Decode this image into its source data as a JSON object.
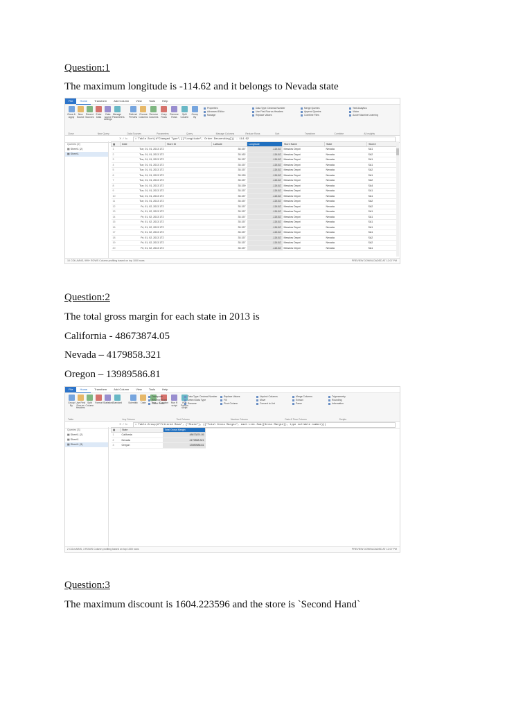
{
  "q1": {
    "heading": "Question:1",
    "text": "The maximum longitude is -114.62 and it belongs to Nevada state",
    "shot": {
      "tabs": [
        "File",
        "Home",
        "Transform",
        "Add Column",
        "View",
        "Tools",
        "Help"
      ],
      "ribbon_lists": [
        [
          "Properties",
          "Advanced Editor",
          "Manage"
        ],
        [
          "Data Type: Decimal Number",
          "Use First Row as Headers",
          "Replace Values"
        ],
        [
          "Merge Queries",
          "Append Queries",
          "Combine Files"
        ],
        [
          "Text Analytics",
          "Vision",
          "Azure Machine Learning"
        ]
      ],
      "ribbon_buttons": [
        "Close & Apply",
        "New Source",
        "Recent Sources",
        "Enter Data",
        "Data source settings",
        "Manage Parameters",
        "Refresh Preview",
        "Choose Columns",
        "Remove Columns",
        "Keep Rows",
        "Remove Rows",
        "Split Column",
        "Group By"
      ],
      "group_labels": [
        "Close",
        "New Query",
        "Data Sources",
        "Parameters",
        "Query",
        "Manage Columns",
        "Reduce Rows",
        "Sort",
        "Transform",
        "Combine",
        "AI Insights"
      ],
      "formula": "= Table.Sort(#\"Changed Type\",{{\"Longitude\", Order.Descending}}) - 114.62",
      "queries_header": "Queries [2]",
      "queries": [
        "Sheet1 (2)",
        "Sheet1"
      ],
      "columns": [
        "Date",
        "Store ID",
        "Latitude",
        "Longitude",
        "Store Name",
        "State",
        "Store2"
      ],
      "rows": [
        [
          "1",
          "Tue, 01, 01, 2013 1T2",
          "",
          "35.157",
          "-114.62",
          "Meadow Depot",
          "Nevada",
          "SA1"
        ],
        [
          "2",
          "Tue, 01, 01, 2013 1T2",
          "",
          "35.162",
          "-114.62",
          "Meadow Depot",
          "Nevada",
          "SA2"
        ],
        [
          "3",
          "Tue, 01, 01, 2013 1T2",
          "",
          "35.157",
          "-114.62",
          "Meadow Depot",
          "Nevada",
          "SA1"
        ],
        [
          "4",
          "Tue, 01, 01, 2013 1T2",
          "",
          "35.157",
          "-114.62",
          "Meadow Depot",
          "Nevada",
          "SA1"
        ],
        [
          "5",
          "Tue, 01, 01, 2013 1T2",
          "",
          "35.157",
          "-114.62",
          "Meadow Depot",
          "Nevada",
          "SA2"
        ],
        [
          "6",
          "Tue, 01, 01, 2013 1T2",
          "",
          "35.159",
          "-114.62",
          "Meadow Depot",
          "Nevada",
          "SA1"
        ],
        [
          "7",
          "Tue, 01, 01, 2013 1T2",
          "",
          "35.157",
          "-114.62",
          "Meadow Depot",
          "Nevada",
          "SA2"
        ],
        [
          "8",
          "Tue, 01, 01, 2013 1T2",
          "",
          "35.159",
          "-114.62",
          "Meadow Depot",
          "Nevada",
          "SA4"
        ],
        [
          "9",
          "Tue, 01, 01, 2013 1T2",
          "",
          "35.157",
          "-114.62",
          "Meadow Depot",
          "Nevada",
          "SA1"
        ],
        [
          "10",
          "Tue, 01, 01, 2013 1T2",
          "",
          "35.157",
          "-114.62",
          "Meadow Depot",
          "Nevada",
          "SA1"
        ],
        [
          "11",
          "Tue, 01, 01, 2013 1T2",
          "",
          "35.157",
          "-114.62",
          "Meadow Depot",
          "Nevada",
          "SA2"
        ],
        [
          "12",
          "Fri, 01, 02, 2013 1T2",
          "",
          "35.157",
          "-114.62",
          "Meadow Depot",
          "Nevada",
          "SA2"
        ],
        [
          "13",
          "Fri, 01, 02, 2013 1T2",
          "",
          "35.157",
          "-114.62",
          "Meadow Depot",
          "Nevada",
          "SA1"
        ],
        [
          "14",
          "Fri, 01, 02, 2013 1T2",
          "",
          "35.157",
          "-114.62",
          "Meadow Depot",
          "Nevada",
          "SA1"
        ],
        [
          "15",
          "Fri, 01, 02, 2013 1T2",
          "",
          "35.157",
          "-114.62",
          "Meadow Depot",
          "Nevada",
          "SA1"
        ],
        [
          "16",
          "Fri, 01, 02, 2013 1T2",
          "",
          "35.157",
          "-114.62",
          "Meadow Depot",
          "Nevada",
          "SA1"
        ],
        [
          "17",
          "Fri, 01, 02, 2013 1T2",
          "",
          "35.157",
          "-114.62",
          "Meadow Depot",
          "Nevada",
          "SA1"
        ],
        [
          "18",
          "Fri, 01, 02, 2013 1T2",
          "",
          "35.157",
          "-114.62",
          "Meadow Depot",
          "Nevada",
          "SA2"
        ],
        [
          "19",
          "Fri, 01, 02, 2013 1T2",
          "",
          "35.157",
          "-114.62",
          "Meadow Depot",
          "Nevada",
          "SA2"
        ],
        [
          "20",
          "Fri, 01, 02, 2013 1T2",
          "",
          "35.157",
          "-114.62",
          "Meadow Depot",
          "Nevada",
          "SA1"
        ]
      ],
      "status_left": "10 COLUMNS, 999+ ROWS    Column profiling based on top 1000 rows",
      "status_right": "PREVIEW DOWNLOADED AT 12:07 PM"
    }
  },
  "q2": {
    "heading": "Question:2",
    "intro": "The total gross margin for each state in 2013 is",
    "lines": [
      "California - 48673874.05",
      "Nevada – 4179858.321",
      "Oregon – 13989586.81"
    ],
    "shot": {
      "tabs": [
        "File",
        "Home",
        "Transform",
        "Add Column",
        "View",
        "Tools",
        "Help"
      ],
      "ribbon_lists": [
        [
          "Transpose",
          "Reverse Rows",
          "Count Rows"
        ],
        [
          "Data Type: Decimal Number",
          "Detect Data Type",
          "Rename"
        ],
        [
          "Replace Values",
          "Fill",
          "Pivot Column"
        ],
        [
          "Unpivot Columns",
          "Move",
          "Convert to List"
        ],
        [
          "Merge Columns",
          "Extract",
          "Parse"
        ],
        [
          "Trigonometry",
          "Rounding",
          "Information"
        ]
      ],
      "ribbon_buttons": [
        "Group By",
        "Use First Row as Headers",
        "Split Column",
        "Format",
        "Statistics",
        "Standard",
        "Scientific",
        "Date",
        "Time",
        "Duration",
        "Run R script",
        "Run Python script"
      ],
      "group_labels": [
        "Table",
        "Any Column",
        "Text Column",
        "Number Column",
        "Date & Time Column",
        "Scripts"
      ],
      "formula": "= Table.Group(#\"Filtered Rows\", {\"State\"}, {{\"Total Gross Margin\", each List.Sum([Gross Margin]), type nullable number}})",
      "queries_header": "Queries [3]",
      "queries": [
        "Sheet1 (2)",
        "Sheet1",
        "Sheet1 (3)"
      ],
      "columns": [
        "State",
        "Total Gross Margin"
      ],
      "rows": [
        [
          "1",
          "California",
          "48673874.05"
        ],
        [
          "2",
          "Nevada",
          "4179858.321"
        ],
        [
          "3",
          "Oregon",
          "13989586.81"
        ]
      ],
      "status_left": "2 COLUMNS, 3 ROWS    Column profiling based on top 1000 rows",
      "status_right": "PREVIEW DOWNLOADED AT 12:07 PM"
    }
  },
  "q3": {
    "heading": "Question:3",
    "text": "The maximum discount is 1604.223596 and the store is `Second Hand`"
  },
  "colors": {
    "accent": "#1f6fbf",
    "file_tab": "#2b73c9"
  }
}
